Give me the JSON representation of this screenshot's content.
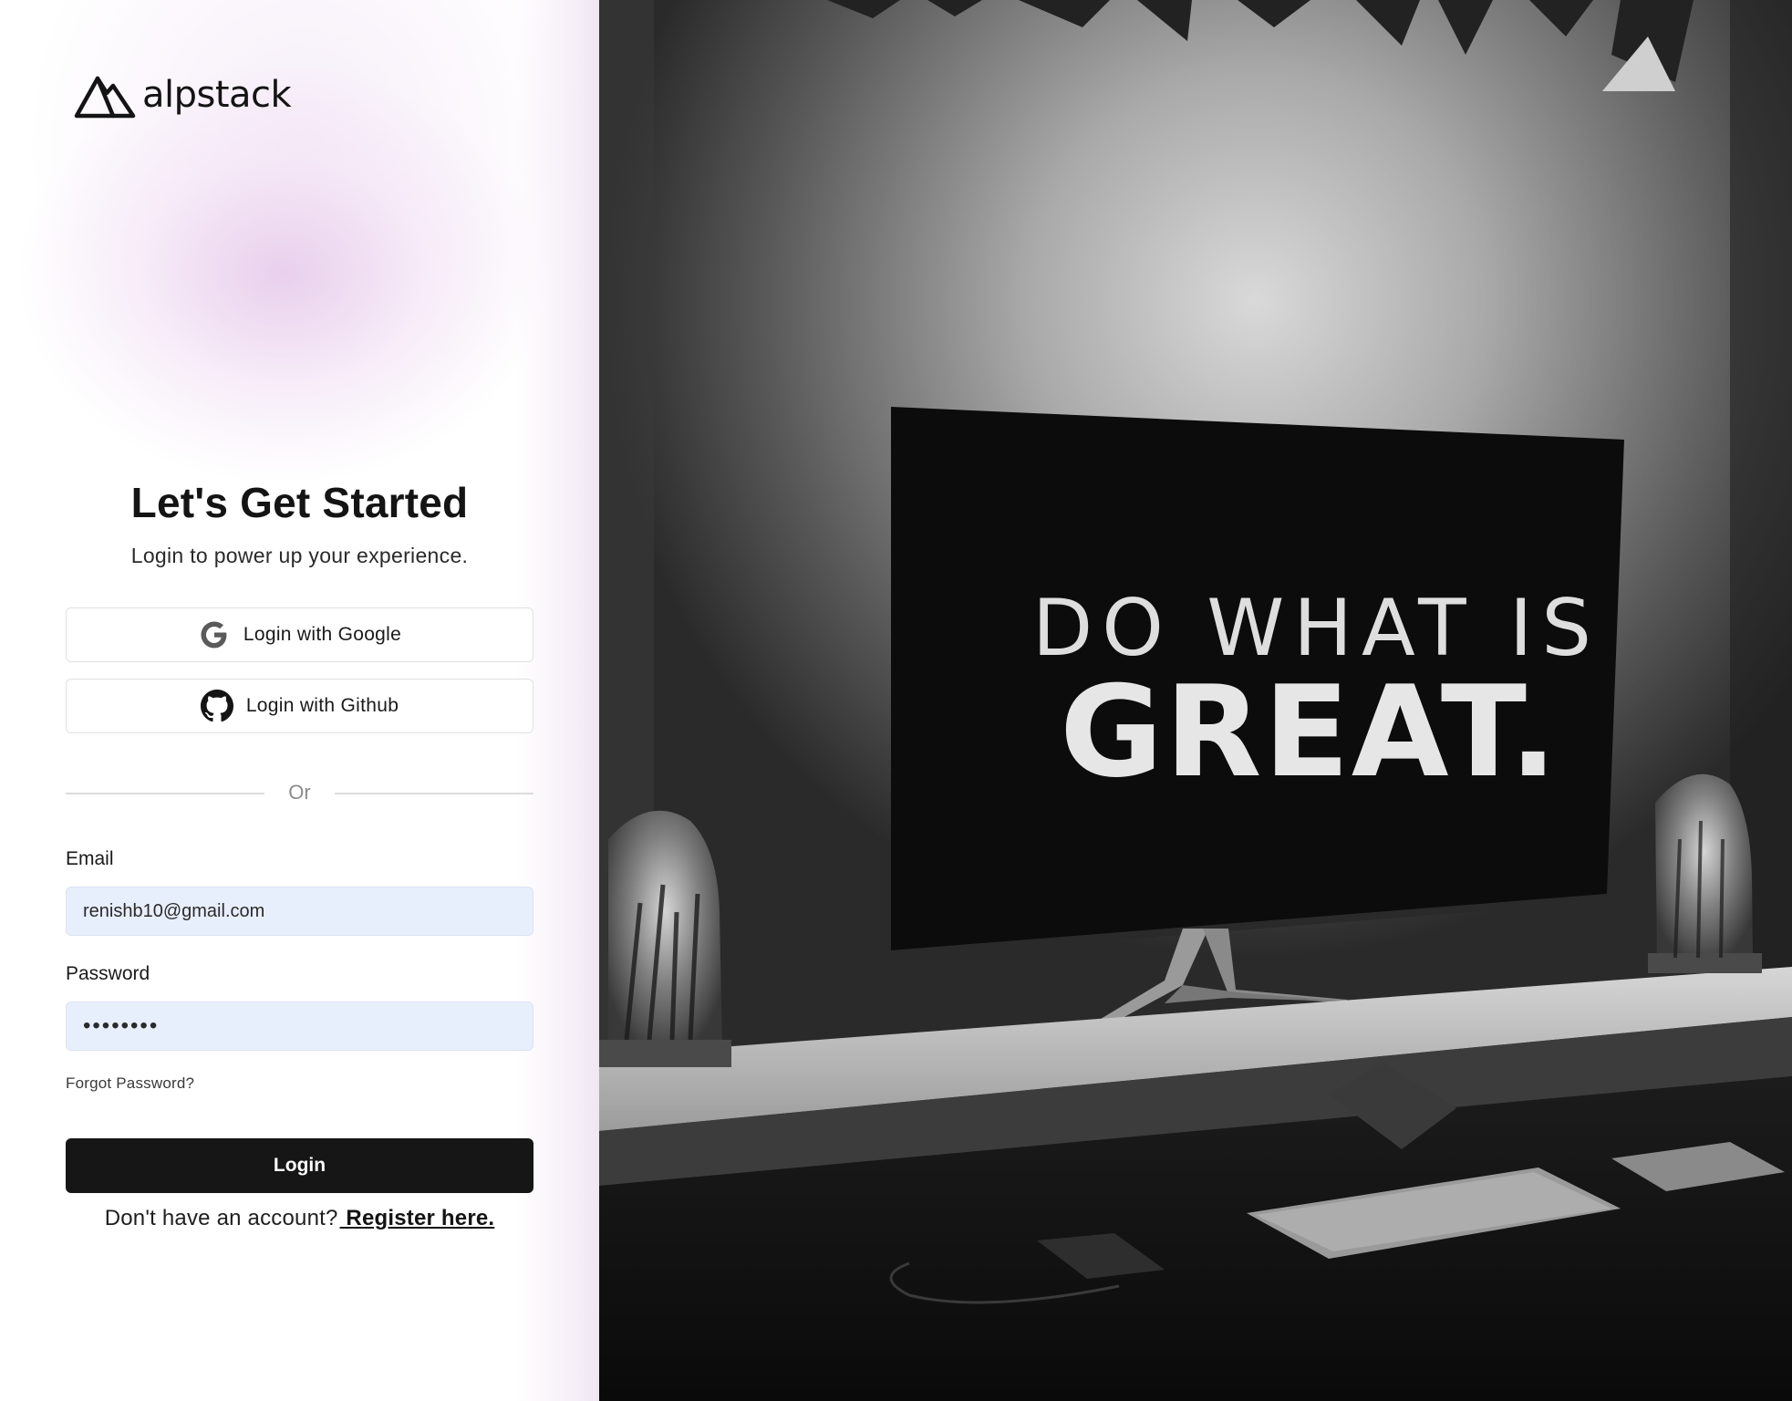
{
  "brand": {
    "name": "alpstack",
    "icon": "mountain-logo-icon"
  },
  "hero": {
    "title": "Let's Get Started",
    "subtitle": "Login to power up your experience."
  },
  "oauth": {
    "google": {
      "label": "Login with Google",
      "icon": "google-icon"
    },
    "github": {
      "label": "Login with Github",
      "icon": "github-icon"
    }
  },
  "divider_text": "Or",
  "form": {
    "email_label": "Email",
    "email_value": "renishb10@gmail.com",
    "password_label": "Password",
    "password_value": "••••••••",
    "forgot_label": "Forgot Password?",
    "login_label": "Login"
  },
  "footer": {
    "prompt": "Don't have an account?",
    "register_label": " Register here."
  },
  "photo": {
    "screen_line1": "DO WHAT IS",
    "screen_line2": "GREAT."
  },
  "colors": {
    "accent_dark": "#161616",
    "input_bg": "#e8effc",
    "glow": "#e8ceec"
  }
}
